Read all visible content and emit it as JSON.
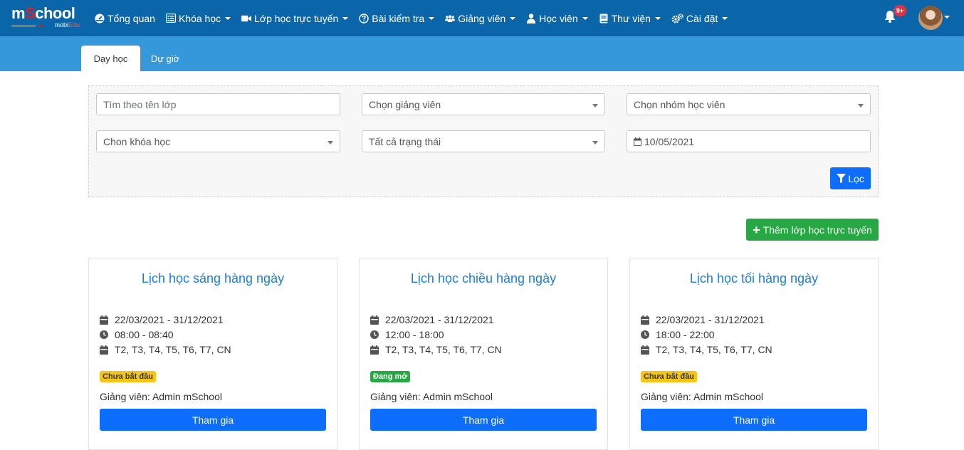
{
  "brand": {
    "logo_pre": "m",
    "logo_accent": "S",
    "logo_post": "chool",
    "sub_pre": "mobi",
    "sub_accent": "Edu",
    "accent_color": "#e02020"
  },
  "nav": {
    "items": [
      {
        "label": "Tổng quan",
        "icon": "dashboard-icon",
        "caret": false
      },
      {
        "label": "Khóa học",
        "icon": "list-icon",
        "caret": true
      },
      {
        "label": "Lớp học trực tuyến",
        "icon": "video-icon",
        "caret": true
      },
      {
        "label": "Bài kiểm tra",
        "icon": "question-circle-icon",
        "caret": true
      },
      {
        "label": "Giảng viên",
        "icon": "users-icon",
        "caret": true
      },
      {
        "label": "Học viên",
        "icon": "user-icon",
        "caret": true
      },
      {
        "label": "Thư viện",
        "icon": "book-icon",
        "caret": true
      },
      {
        "label": "Cài đặt",
        "icon": "cogs-icon",
        "caret": true
      }
    ],
    "notifications_badge": "9+"
  },
  "tabs": {
    "active": "Dạy học",
    "other": "Dự giờ"
  },
  "filters": {
    "class_name_placeholder": "Tìm theo tên lớp",
    "teacher_select": "Chọn giảng viên",
    "student_group_select": "Chọn nhóm học viên",
    "course_select": "Chon khóa học",
    "status_select": "Tất cả trạng thái",
    "date_value": "10/05/2021",
    "filter_button": "Lọc"
  },
  "add_button": "Thêm lớp học trực tuyến",
  "cards": [
    {
      "title": "Lịch học sáng hàng ngày",
      "date_range": "22/03/2021 - 31/12/2021",
      "time": "08:00 - 08:40",
      "days": "T2, T3, T4, T5, T6, T7, CN",
      "status": "Chưa bắt đầu",
      "teacher": "Giảng viên: Admin mSchool",
      "join": "Tham gia"
    },
    {
      "title": "Lịch học chiều hàng ngày",
      "date_range": "22/03/2021 - 31/12/2021",
      "time": "12:00 - 18:00",
      "days": "T2, T3, T4, T5, T6, T7, CN",
      "status": "Đang mở",
      "teacher": "Giảng viên: Admin mSchool",
      "join": "Tham gia"
    },
    {
      "title": "Lịch học tối hàng ngày",
      "date_range": "22/03/2021 - 31/12/2021",
      "time": "18:00 - 22:00",
      "days": "T2, T3, T4, T5, T6, T7, CN",
      "status": "Chưa bắt đầu",
      "teacher": "Giảng viên: Admin mSchool",
      "join": "Tham gia"
    }
  ],
  "colors": {
    "navbar": "#0a66a8",
    "tabbar": "#3498db",
    "primary": "#0d6efd",
    "success": "#28a745",
    "warning": "#f5c518",
    "title": "#1c7ed6"
  }
}
